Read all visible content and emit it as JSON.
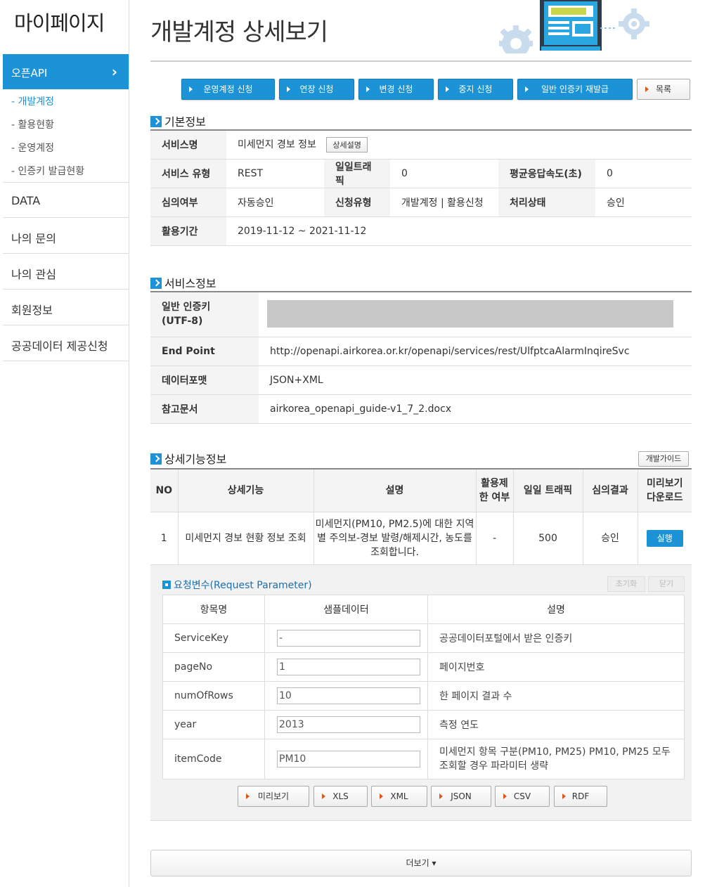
{
  "sidebar": {
    "title": "마이페이지",
    "active_menu": "오픈API",
    "active_chevron": "›",
    "sub_items": [
      "- 개발계정",
      "- 활용현황",
      "- 운영계정",
      "- 인증키 발급현황"
    ],
    "menus": [
      "DATA",
      "나의 문의",
      "나의 관심",
      "회원정보",
      "공공데이터 제공신청"
    ]
  },
  "header": {
    "title": "개발계정 상세보기"
  },
  "actions": {
    "apply_operation": "운영계정 신청",
    "extend": "연장 신청",
    "change": "변경 신청",
    "stop": "중지 신청",
    "reissue_key": "일반 인증키 재발급",
    "list": "목록"
  },
  "basic": {
    "section_title": "기본정보",
    "service_name_label": "서비스명",
    "service_name": "미세먼지 경보 정보",
    "detail_button": "상세설명",
    "service_type_label": "서비스 유형",
    "service_type": "REST",
    "daily_traffic_label": "일일트래픽",
    "daily_traffic": "0",
    "avg_response_label": "평균응답속도(초)",
    "avg_response": "0",
    "review_label": "심의여부",
    "review": "자동승인",
    "apply_type_label": "신청유형",
    "apply_type": "개발계정 | 활용신청",
    "status_label": "처리상태",
    "status": "승인",
    "period_label": "활용기간",
    "period": "2019-11-12 ~ 2021-11-12"
  },
  "service": {
    "section_title": "서비스정보",
    "key_label_1": "일반 인증키",
    "key_label_2": "(UTF-8)",
    "endpoint_label": "End Point",
    "endpoint": "http://openapi.airkorea.or.kr/openapi/services/rest/UlfptcaAlarmInqireSvc",
    "format_label": "데이터포맷",
    "format": "JSON+XML",
    "doc_label": "참고문서",
    "doc": "airkorea_openapi_guide-v1_7_2.docx"
  },
  "functions": {
    "section_title": "상세기능정보",
    "guide_button": "개발가이드",
    "headers": {
      "no": "NO",
      "name": "상세기능",
      "desc": "설명",
      "limit_1": "활용제",
      "limit_2": "한 여부",
      "traffic": "일일 트래픽",
      "result": "심의결과",
      "preview_1": "미리보기",
      "preview_2": "다운로드"
    },
    "rows": [
      {
        "no": "1",
        "name": "미세먼지 경보 현황 정보 조회",
        "desc_1": "미세먼지(PM10, PM2.5)에 대한 지역",
        "desc_2": "별 주의보-경보 발령/해제시간, 농도를",
        "desc_3": "조회합니다.",
        "limit": "-",
        "traffic": "500",
        "result": "승인",
        "run": "실행"
      }
    ]
  },
  "params": {
    "title": "요청변수(Request Parameter)",
    "reset": "초기화",
    "close": "닫기",
    "headers": {
      "name": "항목명",
      "sample": "샘플데이터",
      "desc": "설명"
    },
    "rows": [
      {
        "name": "ServiceKey",
        "value": "-",
        "desc": "공공데이터포털에서 받은 인증키"
      },
      {
        "name": "pageNo",
        "value": "1",
        "desc": "페이지번호"
      },
      {
        "name": "numOfRows",
        "value": "10",
        "desc": "한 페이지 결과 수"
      },
      {
        "name": "year",
        "value": "2013",
        "desc": "측정 연도"
      },
      {
        "name": "itemCode",
        "value": "PM10",
        "desc": "미세먼지 항목 구분(PM10, PM25) PM10, PM25 모두",
        "desc_2": "조회할 경우 파라미터 생략"
      }
    ],
    "buttons": {
      "preview": "미리보기",
      "xls": "XLS",
      "xml": "XML",
      "json": "JSON",
      "csv": "CSV",
      "rdf": "RDF"
    }
  },
  "more_button": "더보기 ▾"
}
